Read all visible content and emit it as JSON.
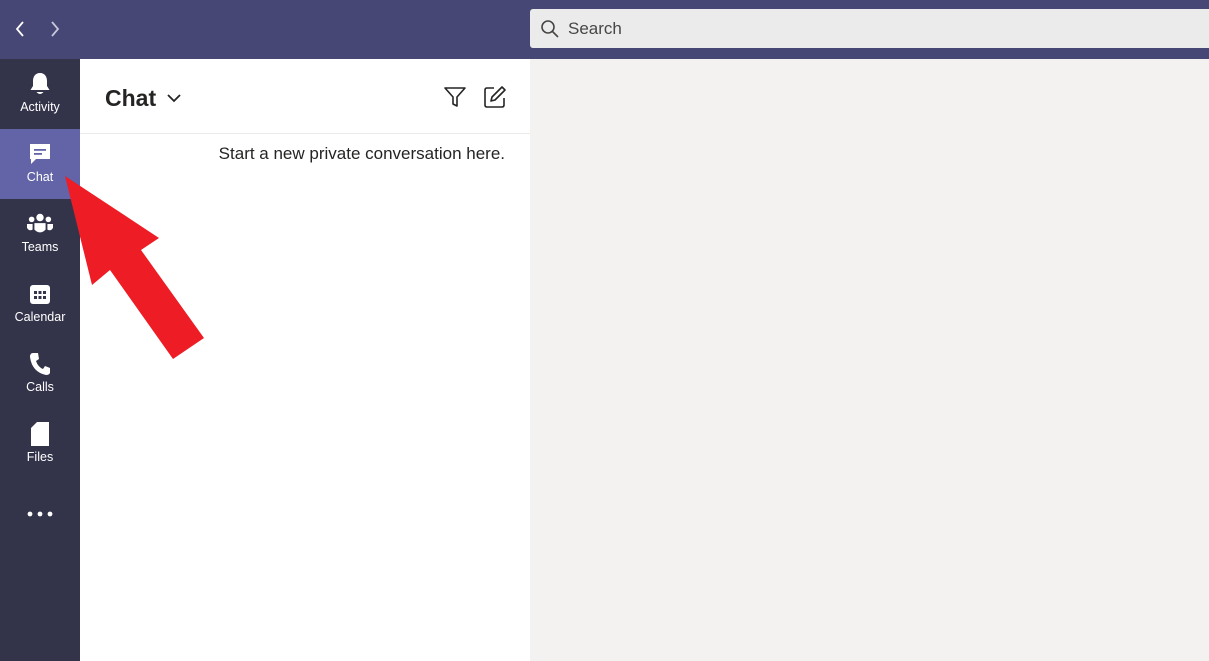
{
  "search": {
    "placeholder": "Search"
  },
  "rail": {
    "items": [
      {
        "label": "Activity"
      },
      {
        "label": "Chat"
      },
      {
        "label": "Teams"
      },
      {
        "label": "Calendar"
      },
      {
        "label": "Calls"
      },
      {
        "label": "Files"
      }
    ],
    "active": "Chat"
  },
  "chat_list": {
    "title": "Chat",
    "empty_message": "Start a new private conversation here."
  },
  "colors": {
    "topbar": "#464775",
    "rail": "#33344a",
    "rail_active": "#6264a7",
    "annotation_arrow": "#ee1c25"
  }
}
